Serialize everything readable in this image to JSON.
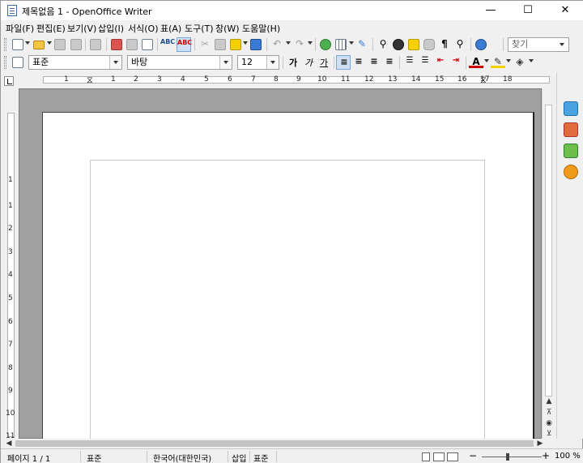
{
  "window": {
    "title": "제목없음 1 - OpenOffice Writer",
    "minimize_glyph": "—",
    "maximize_glyph": "☐",
    "close_glyph": "✕"
  },
  "menu": {
    "items": [
      "파일(F)",
      "편집(E)",
      "보기(V)",
      "삽입(I)",
      "서식(O)",
      "표(A)",
      "도구(T)",
      "창(W)",
      "도움말(H)"
    ]
  },
  "toolbar": {
    "find_placeholder": "찾기",
    "icons": [
      "new-document-icon",
      "open-folder-icon",
      "save-icon",
      "email-icon",
      "edit-file-icon",
      "export-pdf-icon",
      "print-icon",
      "print-preview-icon",
      "spellcheck-icon",
      "autospellcheck-icon",
      "cut-icon",
      "copy-icon",
      "paste-icon",
      "format-paintbrush-icon",
      "undo-icon",
      "redo-icon",
      "hyperlink-icon",
      "table-icon",
      "draw-functions-icon",
      "find-replace-icon",
      "navigator-icon",
      "gallery-icon",
      "datasource-icon",
      "formatting-marks-icon",
      "zoom-icon",
      "help-icon"
    ]
  },
  "formatting": {
    "style_value": "표준",
    "font_value": "바탕",
    "size_value": "12",
    "bold_glyph": "가",
    "italic_glyph": "가",
    "underline_glyph": "가"
  },
  "ruler": {
    "h_labels": [
      "1",
      "1",
      "2",
      "3",
      "4",
      "5",
      "6",
      "7",
      "8",
      "9",
      "10",
      "11",
      "12",
      "13",
      "14",
      "15",
      "16",
      "17",
      "18"
    ],
    "v_labels": [
      "1",
      "1",
      "2",
      "3",
      "4",
      "5",
      "6",
      "7",
      "8",
      "9",
      "10",
      "11"
    ]
  },
  "statusbar": {
    "page": "페이지 1 / 1",
    "style": "표준",
    "language": "한국어(대한민국)",
    "insert_mode": "삽입",
    "selection_mode": "표준",
    "zoom": "100 %"
  }
}
